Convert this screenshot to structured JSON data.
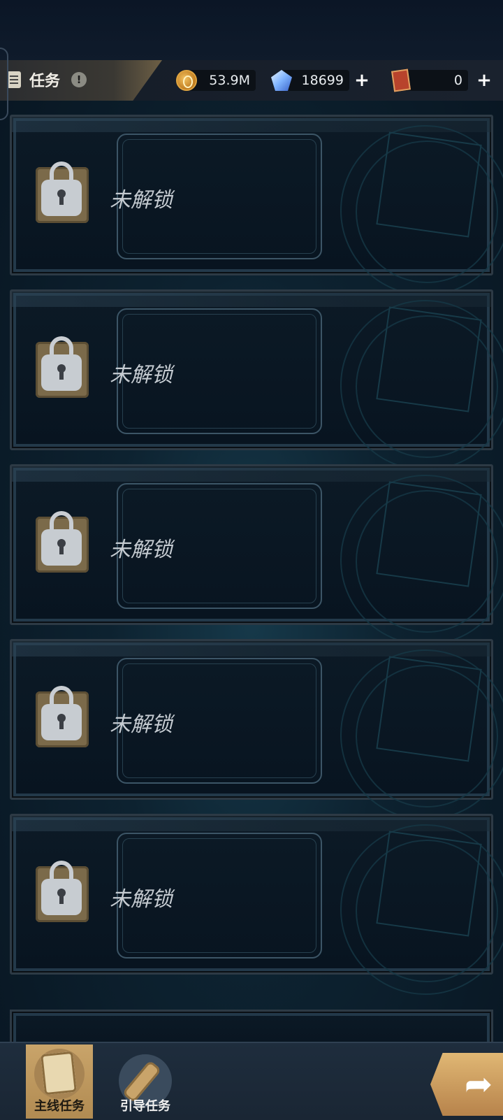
{
  "header": {
    "title": "任务",
    "info_symbol": "!",
    "icon": "quest-scroll-icon"
  },
  "resources": {
    "gold": {
      "icon": "gold-coin-icon",
      "value": "53.9M"
    },
    "gems": {
      "icon": "crystal-gem-icon",
      "value": "18699",
      "add": "+"
    },
    "tickets": {
      "icon": "ticket-card-icon",
      "value": "0",
      "add": "+"
    }
  },
  "quests": [
    {
      "status": "未解锁",
      "icon": "lock-icon"
    },
    {
      "status": "未解锁",
      "icon": "lock-icon"
    },
    {
      "status": "未解锁",
      "icon": "lock-icon"
    },
    {
      "status": "未解锁",
      "icon": "lock-icon"
    },
    {
      "status": "未解锁",
      "icon": "lock-icon"
    }
  ],
  "bottom_nav": {
    "main": {
      "label": "主线任务",
      "icon": "scroll-icon",
      "active": true
    },
    "guide": {
      "label": "引导任务",
      "icon": "rolled-scroll-icon",
      "active": false
    },
    "share": {
      "icon": "share-arrow-icon",
      "symbol": "➦"
    }
  }
}
